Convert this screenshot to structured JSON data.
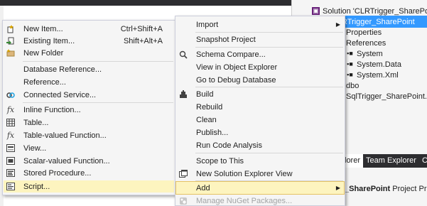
{
  "solution_explorer": {
    "rows": [
      {
        "label": "Solution 'CLRTrigger_SharePoint",
        "icon": "solution-icon"
      },
      {
        "label": "RTrigger_SharePoint",
        "icon": "project-icon"
      },
      {
        "label": "Properties",
        "icon": "properties-icon"
      },
      {
        "label": "References",
        "icon": "references-icon"
      },
      {
        "label": "System",
        "icon": "reference-icon"
      },
      {
        "label": "System.Data",
        "icon": "reference-icon"
      },
      {
        "label": "System.Xml",
        "icon": "reference-icon"
      },
      {
        "label": "dbo",
        "icon": "folder-icon"
      },
      {
        "label": "SqlTrigger_SharePoint.cs",
        "icon": "csharp-file-icon"
      }
    ],
    "tabs": [
      "lorer",
      "Team Explorer",
      "Cla"
    ],
    "properties_title_bold": "_SharePoint",
    "properties_title_rest": "Project Prop"
  },
  "add_submenu": {
    "items": [
      {
        "label": "New Item...",
        "shortcut": "Ctrl+Shift+A",
        "icon": "new-item-icon"
      },
      {
        "label": "Existing Item...",
        "shortcut": "Shift+Alt+A",
        "icon": "existing-item-icon"
      },
      {
        "label": "New Folder",
        "shortcut": "",
        "icon": "new-folder-icon"
      },
      {
        "label": "Database Reference...",
        "shortcut": "",
        "icon": ""
      },
      {
        "label": "Reference...",
        "shortcut": "",
        "icon": ""
      },
      {
        "label": "Connected Service...",
        "shortcut": "",
        "icon": "connected-service-icon"
      },
      {
        "label": "Inline Function...",
        "shortcut": "",
        "icon": "function-icon"
      },
      {
        "label": "Table...",
        "shortcut": "",
        "icon": "table-icon"
      },
      {
        "label": "Table-valued Function...",
        "shortcut": "",
        "icon": "function-icon"
      },
      {
        "label": "View...",
        "shortcut": "",
        "icon": "view-icon"
      },
      {
        "label": "Scalar-valued Function...",
        "shortcut": "",
        "icon": "scalar-function-icon"
      },
      {
        "label": "Stored Procedure...",
        "shortcut": "",
        "icon": "stored-procedure-icon"
      },
      {
        "label": "Script...",
        "shortcut": "",
        "icon": "script-icon"
      }
    ]
  },
  "project_menu": {
    "items": [
      {
        "label": "Import",
        "icon": ""
      },
      {
        "label": "Snapshot Project",
        "icon": ""
      },
      {
        "label": "Schema Compare...",
        "icon": "schema-compare-icon"
      },
      {
        "label": "View in Object Explorer",
        "icon": ""
      },
      {
        "label": "Go to Debug Database",
        "icon": ""
      },
      {
        "label": "Build",
        "icon": "build-icon"
      },
      {
        "label": "Rebuild",
        "icon": ""
      },
      {
        "label": "Clean",
        "icon": ""
      },
      {
        "label": "Publish...",
        "icon": ""
      },
      {
        "label": "Run Code Analysis",
        "icon": ""
      },
      {
        "label": "Scope to This",
        "icon": ""
      },
      {
        "label": "New Solution Explorer View",
        "icon": "new-view-icon"
      },
      {
        "label": "Add",
        "icon": ""
      },
      {
        "label": "Manage NuGet Packages...",
        "icon": "nuget-icon"
      }
    ]
  },
  "colors": {
    "menu_bg": "#f5f5f5",
    "highlight": "#fdf4bf",
    "selection": "#3399ff"
  }
}
